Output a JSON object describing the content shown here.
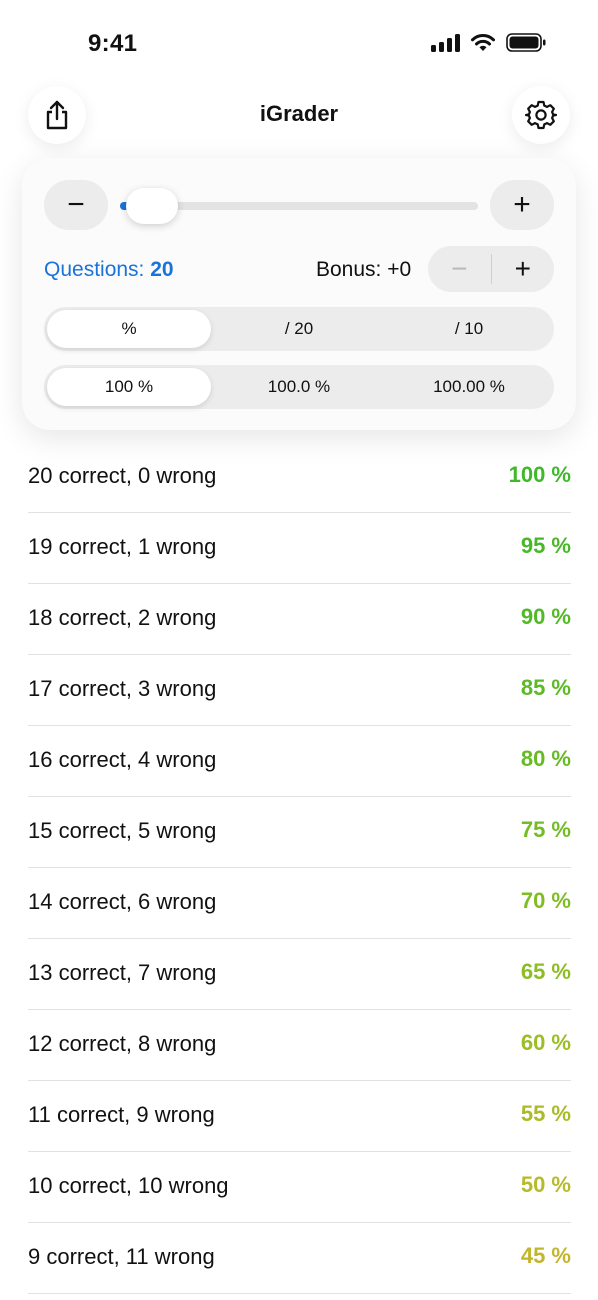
{
  "status_bar": {
    "time": "9:41",
    "icons": [
      "signal-icon",
      "wifi-icon",
      "battery-icon"
    ]
  },
  "nav": {
    "title": "iGrader",
    "left_icon": "share-icon",
    "right_icon": "gear-icon"
  },
  "controls": {
    "slider_minus": "−",
    "slider_plus": "+",
    "slider_fraction": 0.02,
    "questions_label": "Questions:",
    "questions_value": "20",
    "bonus_label": "Bonus: +0",
    "bonus_minus": "−",
    "bonus_plus": "+",
    "format_options": [
      "%",
      "/ 20",
      "/ 10"
    ],
    "format_selected": 0,
    "precision_options": [
      "100 %",
      "100.0 %",
      "100.00 %"
    ],
    "precision_selected": 0,
    "accent_color": "#1a73d8"
  },
  "rows": [
    {
      "label": "20 correct, 0 wrong",
      "pct": "100 %",
      "color": "#3fb82a"
    },
    {
      "label": "19 correct, 1 wrong",
      "pct": "95 %",
      "color": "#49b828"
    },
    {
      "label": "18 correct, 2 wrong",
      "pct": "90 %",
      "color": "#52b927"
    },
    {
      "label": "17 correct, 3 wrong",
      "pct": "85 %",
      "color": "#5cba26"
    },
    {
      "label": "16 correct, 4 wrong",
      "pct": "80 %",
      "color": "#66bb25"
    },
    {
      "label": "15 correct, 5 wrong",
      "pct": "75 %",
      "color": "#72bc24"
    },
    {
      "label": "14 correct, 6 wrong",
      "pct": "70 %",
      "color": "#7fbd24"
    },
    {
      "label": "13 correct, 7 wrong",
      "pct": "65 %",
      "color": "#8cbd24"
    },
    {
      "label": "12 correct, 8 wrong",
      "pct": "60 %",
      "color": "#9cbd26"
    },
    {
      "label": "11 correct, 9 wrong",
      "pct": "55 %",
      "color": "#a9bc28"
    },
    {
      "label": "10 correct, 10 wrong",
      "pct": "50 %",
      "color": "#b7ba2b"
    },
    {
      "label": "9 correct, 11 wrong",
      "pct": "45 %",
      "color": "#c3b62d"
    }
  ]
}
